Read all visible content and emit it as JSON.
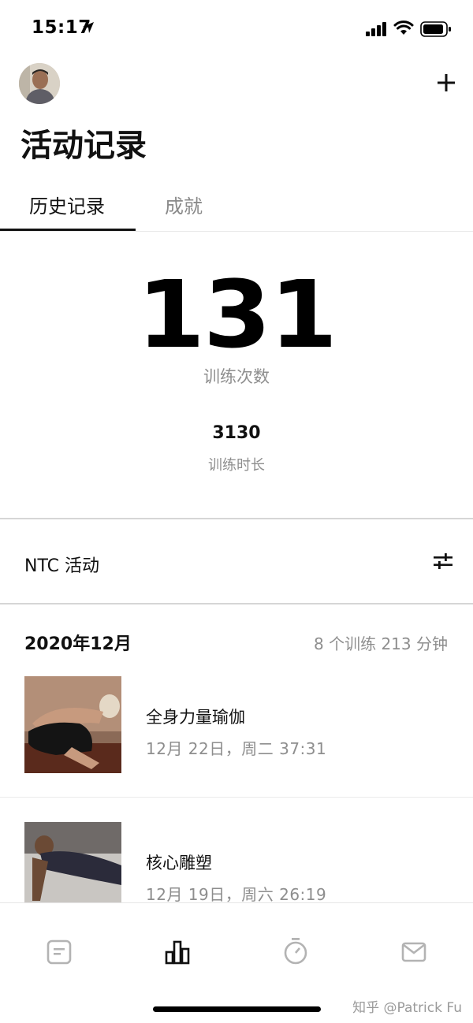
{
  "status_bar": {
    "time": "15:17"
  },
  "header": {
    "title": "活动记录"
  },
  "tabs": [
    {
      "label": "历史记录",
      "active": true
    },
    {
      "label": "成就",
      "active": false
    }
  ],
  "stats": {
    "workout_count": "131",
    "workout_count_label": "训练次数",
    "duration_value": "3130",
    "duration_label": "训练时长"
  },
  "activity_section": {
    "label": "NTC 活动"
  },
  "month": {
    "title": "2020年12月",
    "summary": "8 个训练   213 分钟"
  },
  "workouts": [
    {
      "name": "全身力量瑜伽",
      "meta": "12月 22日，周二   37:31"
    },
    {
      "name": "核心雕塑",
      "meta": "12月 19日，周六   26:19"
    }
  ],
  "bottom_nav": [
    {
      "icon": "feed-icon",
      "active": false
    },
    {
      "icon": "activity-icon",
      "active": true
    },
    {
      "icon": "stopwatch-icon",
      "active": false
    },
    {
      "icon": "inbox-icon",
      "active": false
    }
  ],
  "watermark": "知乎 @Patrick Fu",
  "colors": {
    "primary": "#111111",
    "secondary_text": "#8e8e8e",
    "inactive_icon": "#b3b3b3"
  }
}
